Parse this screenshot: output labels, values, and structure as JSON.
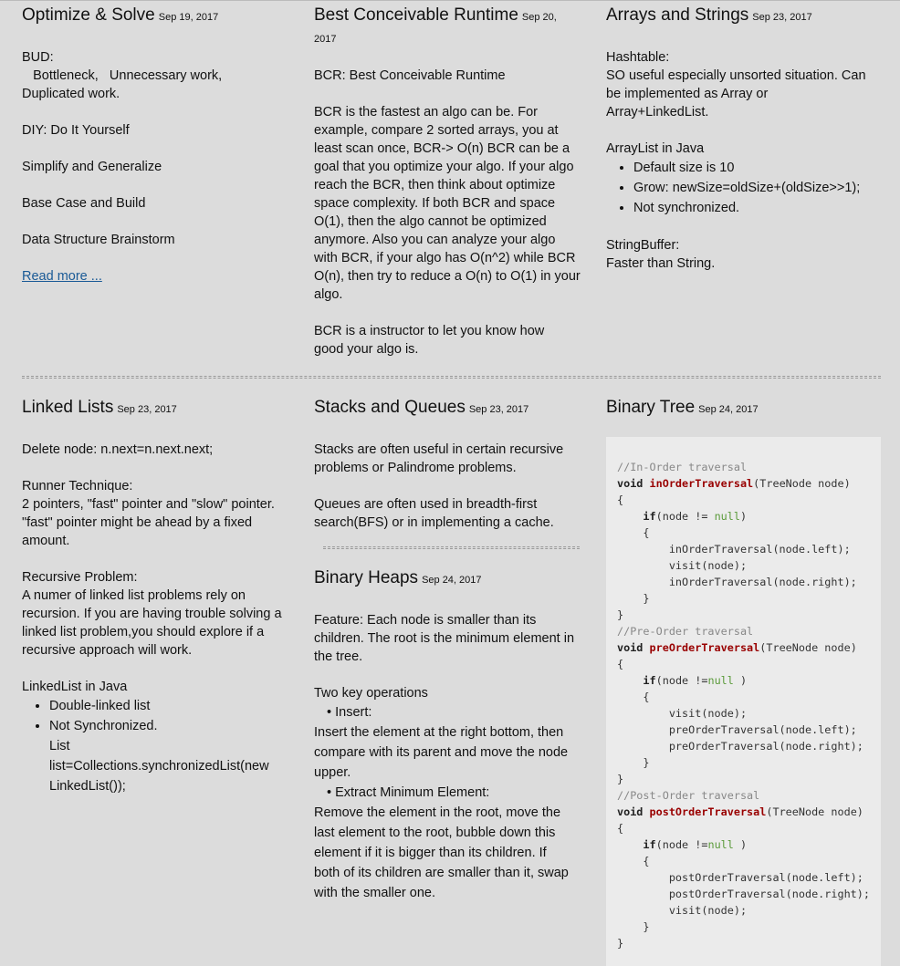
{
  "posts": {
    "optimize": {
      "title": "Optimize & Solve",
      "date": "Sep 19, 2017",
      "lines": [
        "BUD:",
        "   Bottleneck,   Unnecessary work,",
        "Duplicated work.",
        "DIY: Do It Yourself",
        "Simplify and Generalize",
        "Base Case and Build",
        "Data Structure Brainstorm"
      ],
      "read_more": "Read more ..."
    },
    "bcr": {
      "title": "Best Conceivable Runtime",
      "date": "Sep 20,",
      "date2": "2017",
      "p1": "BCR: Best Conceivable Runtime",
      "p2": [
        "BCR is the fastest an algo can be. For",
        "example, compare 2 sorted arrays, you at",
        "least scan once, BCR-> O(n) BCR can be a",
        "goal that you optimize your algo. If your algo",
        "reach the BCR, then think about optimize",
        "space complexity. If both BCR and space",
        "O(1), then the algo cannot be optimized",
        "anymore. Also you can analyze your algo",
        "with BCR, if your algo has O(n^2) while BCR",
        "O(n), then try to reduce a O(n) to O(1) in your",
        "algo."
      ],
      "p3": [
        "BCR is a instructor to let you know how",
        "good your algo is."
      ]
    },
    "arrays": {
      "title": "Arrays and Strings",
      "date": "Sep 23, 2017",
      "hashtable": "Hashtable:",
      "hash_desc": [
        "SO useful especially unsorted situation. Can",
        "be implemented as Array or",
        "Array+LinkedList."
      ],
      "arraylist": "ArrayList in Java",
      "bullets": [
        "Default size is 10",
        "Grow: newSize=oldSize+(oldSize>>1);",
        "Not synchronized."
      ],
      "sb": "StringBuffer:",
      "sb_desc": "Faster than String."
    },
    "linked": {
      "title": "Linked Lists",
      "date": "Sep 23, 2017",
      "delete": "Delete node: n.next=n.next.next;",
      "runner": "Runner Technique:",
      "runner_desc": [
        "2 pointers, \"fast\" pointer and \"slow\" pointer.",
        "\"fast\" pointer might be ahead by a fixed",
        "amount."
      ],
      "rec": "Recursive Problem:",
      "rec_desc": [
        "A numer of linked list problems rely on",
        "recursion. If you are having trouble solving a",
        "linked list problem,you should explore if a",
        "recursive approach will work."
      ],
      "ll": "LinkedList in Java",
      "bullets": [
        "Double-linked list",
        "Not Synchronized."
      ],
      "sub": [
        "List",
        "list=Collections.synchronizedList(new",
        "LinkedList());"
      ]
    },
    "stacks": {
      "title": "Stacks and Queues",
      "date": "Sep 23, 2017",
      "p1": [
        "Stacks are often useful in certain recursive",
        "problems or Palindrome problems."
      ],
      "p2": [
        "Queues are often used in breadth-first",
        "search(BFS) or in implementing a cache."
      ]
    },
    "heaps": {
      "title": "Binary Heaps",
      "date": "Sep 24, 2017",
      "feature": [
        "Feature: Each node is smaller than its",
        "children. The root is the minimum element in",
        "the tree."
      ],
      "two": "Two key operations",
      "insert": "Insert:",
      "insert_desc": [
        "Insert the element at the right bottom, then",
        "compare with its parent and move the node",
        "upper."
      ],
      "extract": "Extract Minimum Element:",
      "extract_desc": [
        "Remove the element in the root, move the",
        "last element to the root, bubble down this",
        "element if it is bigger than its children. If",
        "both of its children are smaller than it, swap",
        "with the smaller one."
      ]
    },
    "tree": {
      "title": "Binary Tree",
      "date": "Sep 24, 2017",
      "code": [
        {
          "t": "cm",
          "s": "//In-Order traversal"
        },
        {
          "t": "sig",
          "kw": "void ",
          "fn": "inOrderTraversal",
          "rest": "(TreeNode node)"
        },
        {
          "t": "pl",
          "s": "{"
        },
        {
          "t": "if",
          "pre": "    ",
          "kw": "if",
          "a": "(node != ",
          "nl": "null",
          "b": ")"
        },
        {
          "t": "pl",
          "s": "    {"
        },
        {
          "t": "pl",
          "s": "        inOrderTraversal(node.left);"
        },
        {
          "t": "pl",
          "s": "        visit(node);"
        },
        {
          "t": "pl",
          "s": "        inOrderTraversal(node.right);"
        },
        {
          "t": "pl",
          "s": "    }"
        },
        {
          "t": "pl",
          "s": "}"
        },
        {
          "t": "cm",
          "s": "//Pre-Order traversal"
        },
        {
          "t": "sig",
          "kw": "void ",
          "fn": "preOrderTraversal",
          "rest": "(TreeNode node)"
        },
        {
          "t": "pl",
          "s": "{"
        },
        {
          "t": "if",
          "pre": "    ",
          "kw": "if",
          "a": "(node !=",
          "nl": "null",
          "b": " )"
        },
        {
          "t": "pl",
          "s": "    {"
        },
        {
          "t": "pl",
          "s": "        visit(node);"
        },
        {
          "t": "pl",
          "s": "        preOrderTraversal(node.left);"
        },
        {
          "t": "pl",
          "s": "        preOrderTraversal(node.right);"
        },
        {
          "t": "pl",
          "s": "    }"
        },
        {
          "t": "pl",
          "s": "}"
        },
        {
          "t": "cm",
          "s": "//Post-Order traversal"
        },
        {
          "t": "sig",
          "kw": "void ",
          "fn": "postOrderTraversal",
          "rest": "(TreeNode node)"
        },
        {
          "t": "pl",
          "s": "{"
        },
        {
          "t": "if",
          "pre": "    ",
          "kw": "if",
          "a": "(node !=",
          "nl": "null",
          "b": " )"
        },
        {
          "t": "pl",
          "s": "    {"
        },
        {
          "t": "pl",
          "s": "        postOrderTraversal(node.left);"
        },
        {
          "t": "pl",
          "s": "        postOrderTraversal(node.right);"
        },
        {
          "t": "pl",
          "s": "        visit(node);"
        },
        {
          "t": "pl",
          "s": "    }"
        },
        {
          "t": "pl",
          "s": "}"
        }
      ]
    }
  }
}
